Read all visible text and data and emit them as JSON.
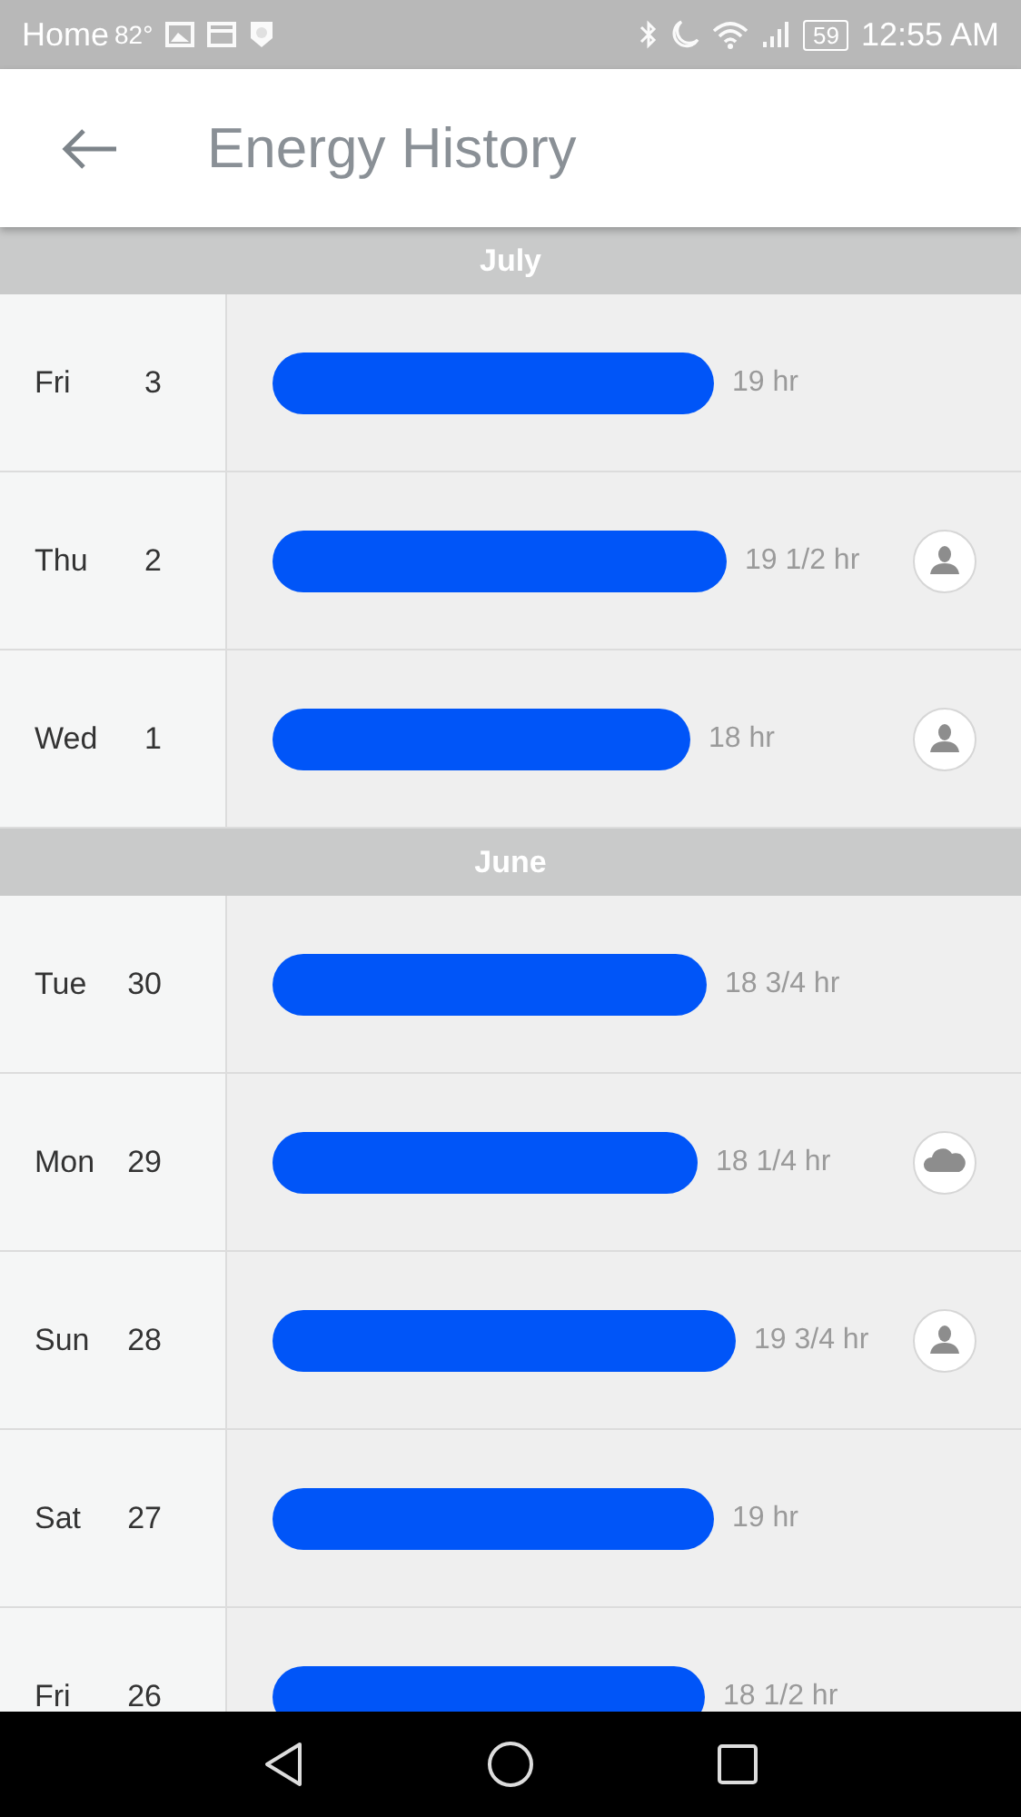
{
  "status_bar": {
    "carrier": "Home",
    "temperature": "82°",
    "battery": "59",
    "time": "12:55 AM"
  },
  "header": {
    "title": "Energy History"
  },
  "months": [
    {
      "name": "July",
      "days": [
        {
          "kind": "plain",
          "weekday": "Fri",
          "date": "3",
          "duration": "19 hr"
        },
        {
          "kind": "person",
          "weekday": "Thu",
          "date": "2",
          "duration": "19 1/2 hr"
        },
        {
          "kind": "person",
          "weekday": "Wed",
          "date": "1",
          "duration": "18 hr"
        }
      ]
    },
    {
      "name": "June",
      "days": [
        {
          "kind": "plain",
          "weekday": "Tue",
          "date": "30",
          "duration": "18 3/4 hr"
        },
        {
          "kind": "cloud",
          "weekday": "Mon",
          "date": "29",
          "duration": "18 1/4 hr"
        },
        {
          "kind": "person",
          "weekday": "Sun",
          "date": "28",
          "duration": "19 3/4 hr"
        },
        {
          "kind": "plain",
          "weekday": "Sat",
          "date": "27",
          "duration": "19 hr"
        },
        {
          "kind": "plain",
          "weekday": "Fri",
          "date": "26",
          "duration": "18 1/2 hr"
        }
      ]
    }
  ]
}
